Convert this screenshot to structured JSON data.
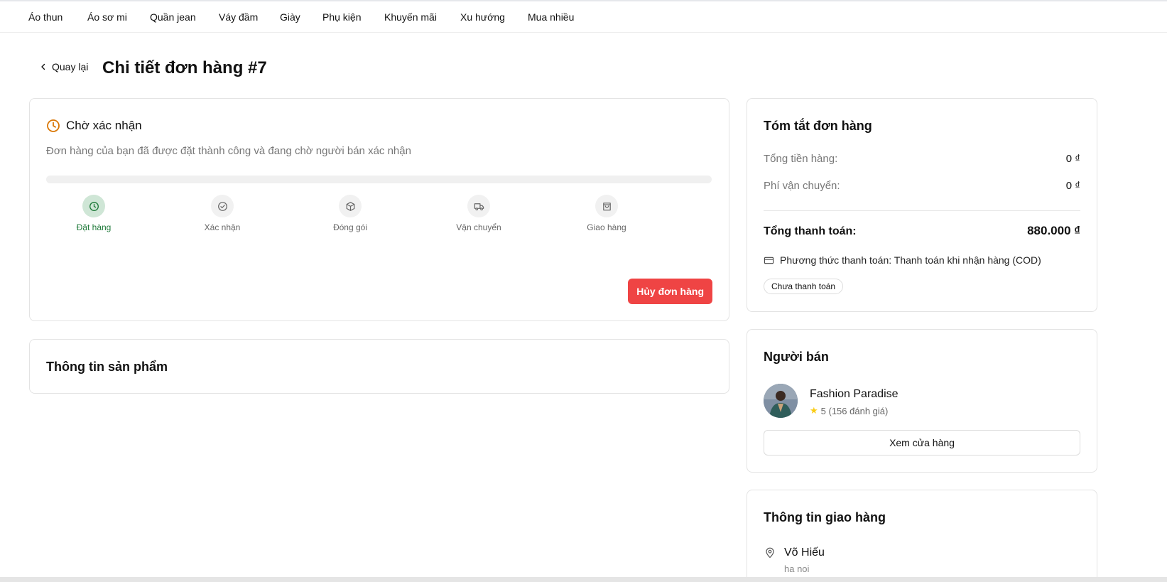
{
  "nav": {
    "items": [
      "Áo thun",
      "Áo sơ mi",
      "Quần jean",
      "Váy đầm",
      "Giày",
      "Phụ kiện",
      "Khuyến mãi",
      "Xu hướng",
      "Mua nhiều"
    ]
  },
  "header": {
    "back_label": "Quay lại",
    "title": "Chi tiết đơn hàng #7"
  },
  "status": {
    "title": "Chờ xác nhận",
    "description": "Đơn hàng của bạn đã được đặt thành công và đang chờ người bán xác nhận",
    "progress": 0,
    "steps": [
      {
        "label": "Đặt hàng",
        "icon": "clock-icon",
        "active": true
      },
      {
        "label": "Xác nhận",
        "icon": "check-circle-icon",
        "active": false
      },
      {
        "label": "Đóng gói",
        "icon": "package-icon",
        "active": false
      },
      {
        "label": "Vận chuyển",
        "icon": "truck-icon",
        "active": false
      },
      {
        "label": "Giao hàng",
        "icon": "shopping-bag-icon",
        "active": false
      }
    ],
    "cancel_label": "Hủy đơn hàng"
  },
  "product": {
    "title": "Thông tin sản phẩm"
  },
  "summary": {
    "title": "Tóm tắt đơn hàng",
    "subtotal_label": "Tổng tiền hàng:",
    "subtotal_value": "0 ₫",
    "shipping_label": "Phí vận chuyển:",
    "shipping_value": "0 ₫",
    "total_label": "Tổng thanh toán:",
    "total_value": "880.000 ₫",
    "payment_method": "Phương thức thanh toán: Thanh toán khi nhận hàng (COD)",
    "payment_status": "Chưa thanh toán"
  },
  "seller": {
    "title": "Người bán",
    "name": "Fashion Paradise",
    "rating": "5 (156 đánh giá)",
    "view_store_label": "Xem cửa hàng"
  },
  "shipping": {
    "title": "Thông tin giao hàng",
    "recipient": "Võ Hiếu",
    "address": "ha noi"
  },
  "colors": {
    "accent_green": "#16a34a",
    "active_step_bg": "#cfe6d6",
    "cancel_red": "#ef4444",
    "pending_amber": "#d97706",
    "star_yellow": "#facc15"
  }
}
